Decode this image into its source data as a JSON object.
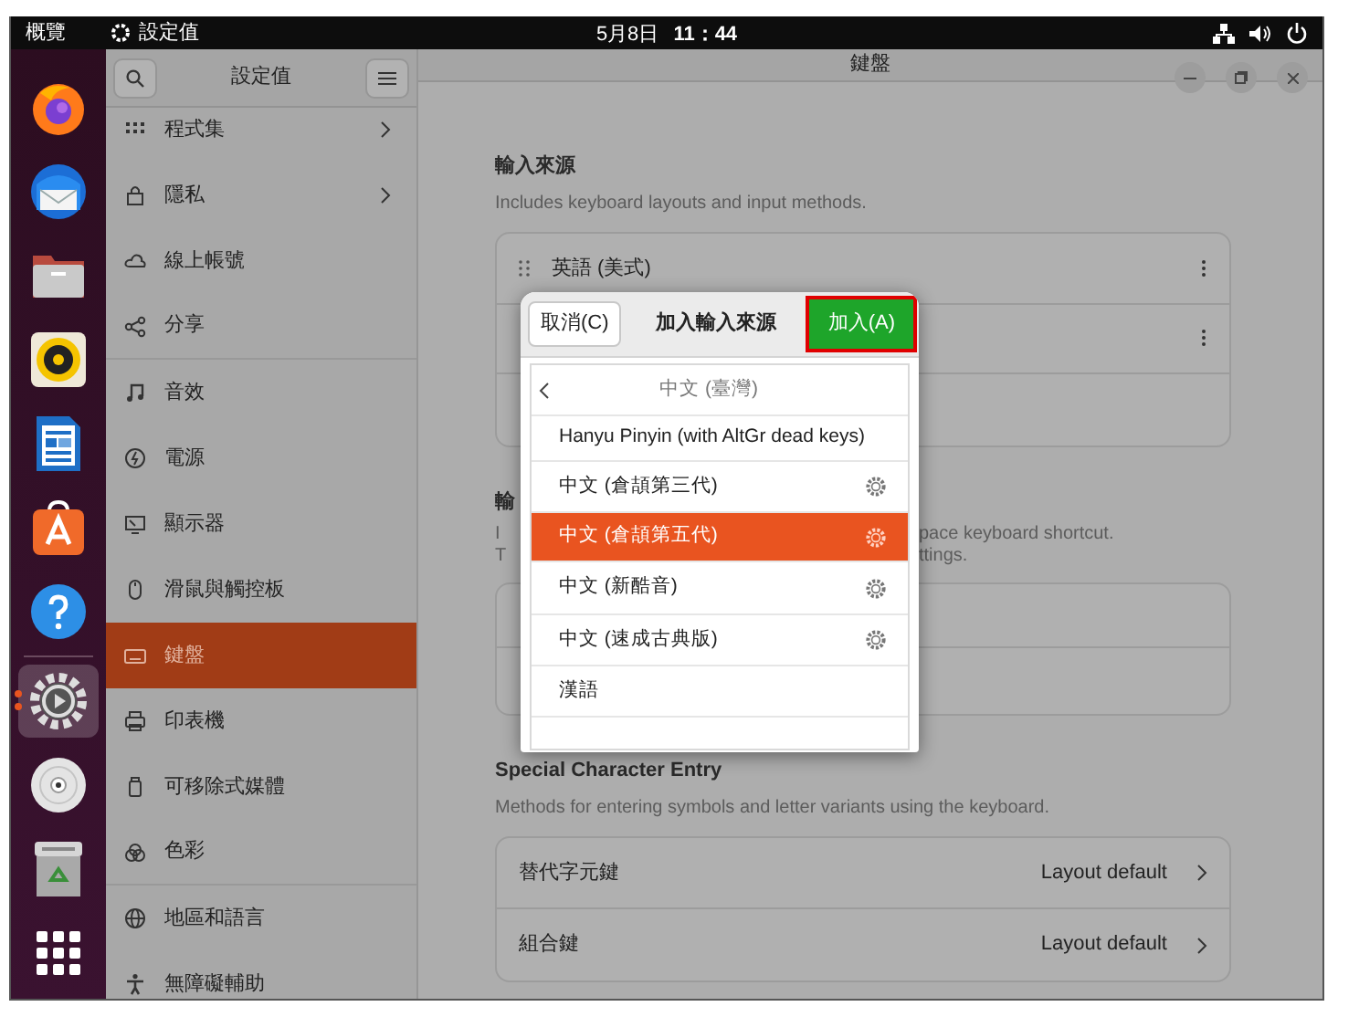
{
  "top_bar": {
    "activities": "概覽",
    "app_name": "設定值",
    "date": "5月8日",
    "time": "11：44"
  },
  "dock": [
    {
      "kind": "firefox",
      "running": false
    },
    {
      "kind": "thunderbird",
      "running": false
    },
    {
      "kind": "files",
      "running": false
    },
    {
      "kind": "rhythmbox",
      "running": false
    },
    {
      "kind": "writer",
      "running": false
    },
    {
      "kind": "appcenter",
      "running": false
    },
    {
      "kind": "help",
      "running": false
    },
    {
      "kind": "separator"
    },
    {
      "kind": "settings",
      "running": true
    },
    {
      "kind": "disc",
      "running": false
    },
    {
      "kind": "trash",
      "running": false
    },
    {
      "kind": "appgrid",
      "running": false
    }
  ],
  "sidebar": {
    "title": "設定值",
    "items": [
      {
        "kind": "apps",
        "label": "程式集",
        "has_arrow": true,
        "selected": false,
        "divider_after": false
      },
      {
        "kind": "lock",
        "label": "隱私",
        "has_arrow": true,
        "selected": false,
        "divider_after": false
      },
      {
        "kind": "cloud",
        "label": "線上帳號",
        "has_arrow": false,
        "selected": false,
        "divider_after": false
      },
      {
        "kind": "share",
        "label": "分享",
        "has_arrow": false,
        "selected": false,
        "divider_after": true
      },
      {
        "kind": "music",
        "label": "音效",
        "has_arrow": false,
        "selected": false,
        "divider_after": false
      },
      {
        "kind": "power",
        "label": "電源",
        "has_arrow": false,
        "selected": false,
        "divider_after": false
      },
      {
        "kind": "display",
        "label": "顯示器",
        "has_arrow": false,
        "selected": false,
        "divider_after": false
      },
      {
        "kind": "mouse",
        "label": "滑鼠與觸控板",
        "has_arrow": false,
        "selected": false,
        "divider_after": false
      },
      {
        "kind": "keyboard",
        "label": "鍵盤",
        "has_arrow": false,
        "selected": true,
        "divider_after": false
      },
      {
        "kind": "printer",
        "label": "印表機",
        "has_arrow": false,
        "selected": false,
        "divider_after": false
      },
      {
        "kind": "removable",
        "label": "可移除式媒體",
        "has_arrow": false,
        "selected": false,
        "divider_after": false
      },
      {
        "kind": "color",
        "label": "色彩",
        "has_arrow": false,
        "selected": false,
        "divider_after": true
      },
      {
        "kind": "globe",
        "label": "地區和語言",
        "has_arrow": false,
        "selected": false,
        "divider_after": false
      },
      {
        "kind": "accessibility",
        "label": "無障礙輔助",
        "has_arrow": false,
        "selected": false,
        "divider_after": false
      }
    ]
  },
  "main": {
    "title": "鍵盤",
    "sections": [
      {
        "heading": [
          "輸入來源"
        ],
        "description": [
          [
            "Includes keyboard layouts and input methods."
          ]
        ],
        "rows": [
          {
            "kind": "source",
            "label": "英語 (美式)"
          },
          {
            "kind": "menu_only"
          },
          {
            "kind": "blank"
          }
        ]
      },
      {
        "heading": [
          "輸"
        ],
        "description": [
          [
            "I",
            "pace keyboard shortcut."
          ],
          [
            "T",
            "ttings."
          ]
        ],
        "rows": [
          {
            "kind": "blank"
          },
          {
            "kind": "blank"
          }
        ]
      },
      {
        "heading": [
          "Special Character Entry"
        ],
        "description": [
          [
            "Methods for entering symbols and letter variants using the keyboard."
          ]
        ],
        "rows": [
          {
            "kind": "value",
            "label": "替代字元鍵",
            "value": "Layout default"
          },
          {
            "kind": "value",
            "label": "組合鍵",
            "value": "Layout default"
          }
        ]
      }
    ]
  },
  "dialog": {
    "title": "加入輸入來源",
    "cancel": "取消(C)",
    "add": {
      "label": "加入(A)",
      "highlighted": true
    },
    "back_label": "中文 (臺灣)",
    "items": [
      {
        "label": "Hanyu Pinyin (with AltGr dead keys)",
        "has_settings": false,
        "selected": false
      },
      {
        "label": "中文 (倉頡第三代)",
        "has_settings": true,
        "selected": false
      },
      {
        "label": "中文 (倉頡第五代)",
        "has_settings": true,
        "selected": true
      },
      {
        "label": "中文 (新酷音)",
        "has_settings": true,
        "selected": false
      },
      {
        "label": "中文 (速成古典版)",
        "has_settings": true,
        "selected": false
      },
      {
        "label": "漢語",
        "has_settings": false,
        "selected": false
      }
    ]
  }
}
